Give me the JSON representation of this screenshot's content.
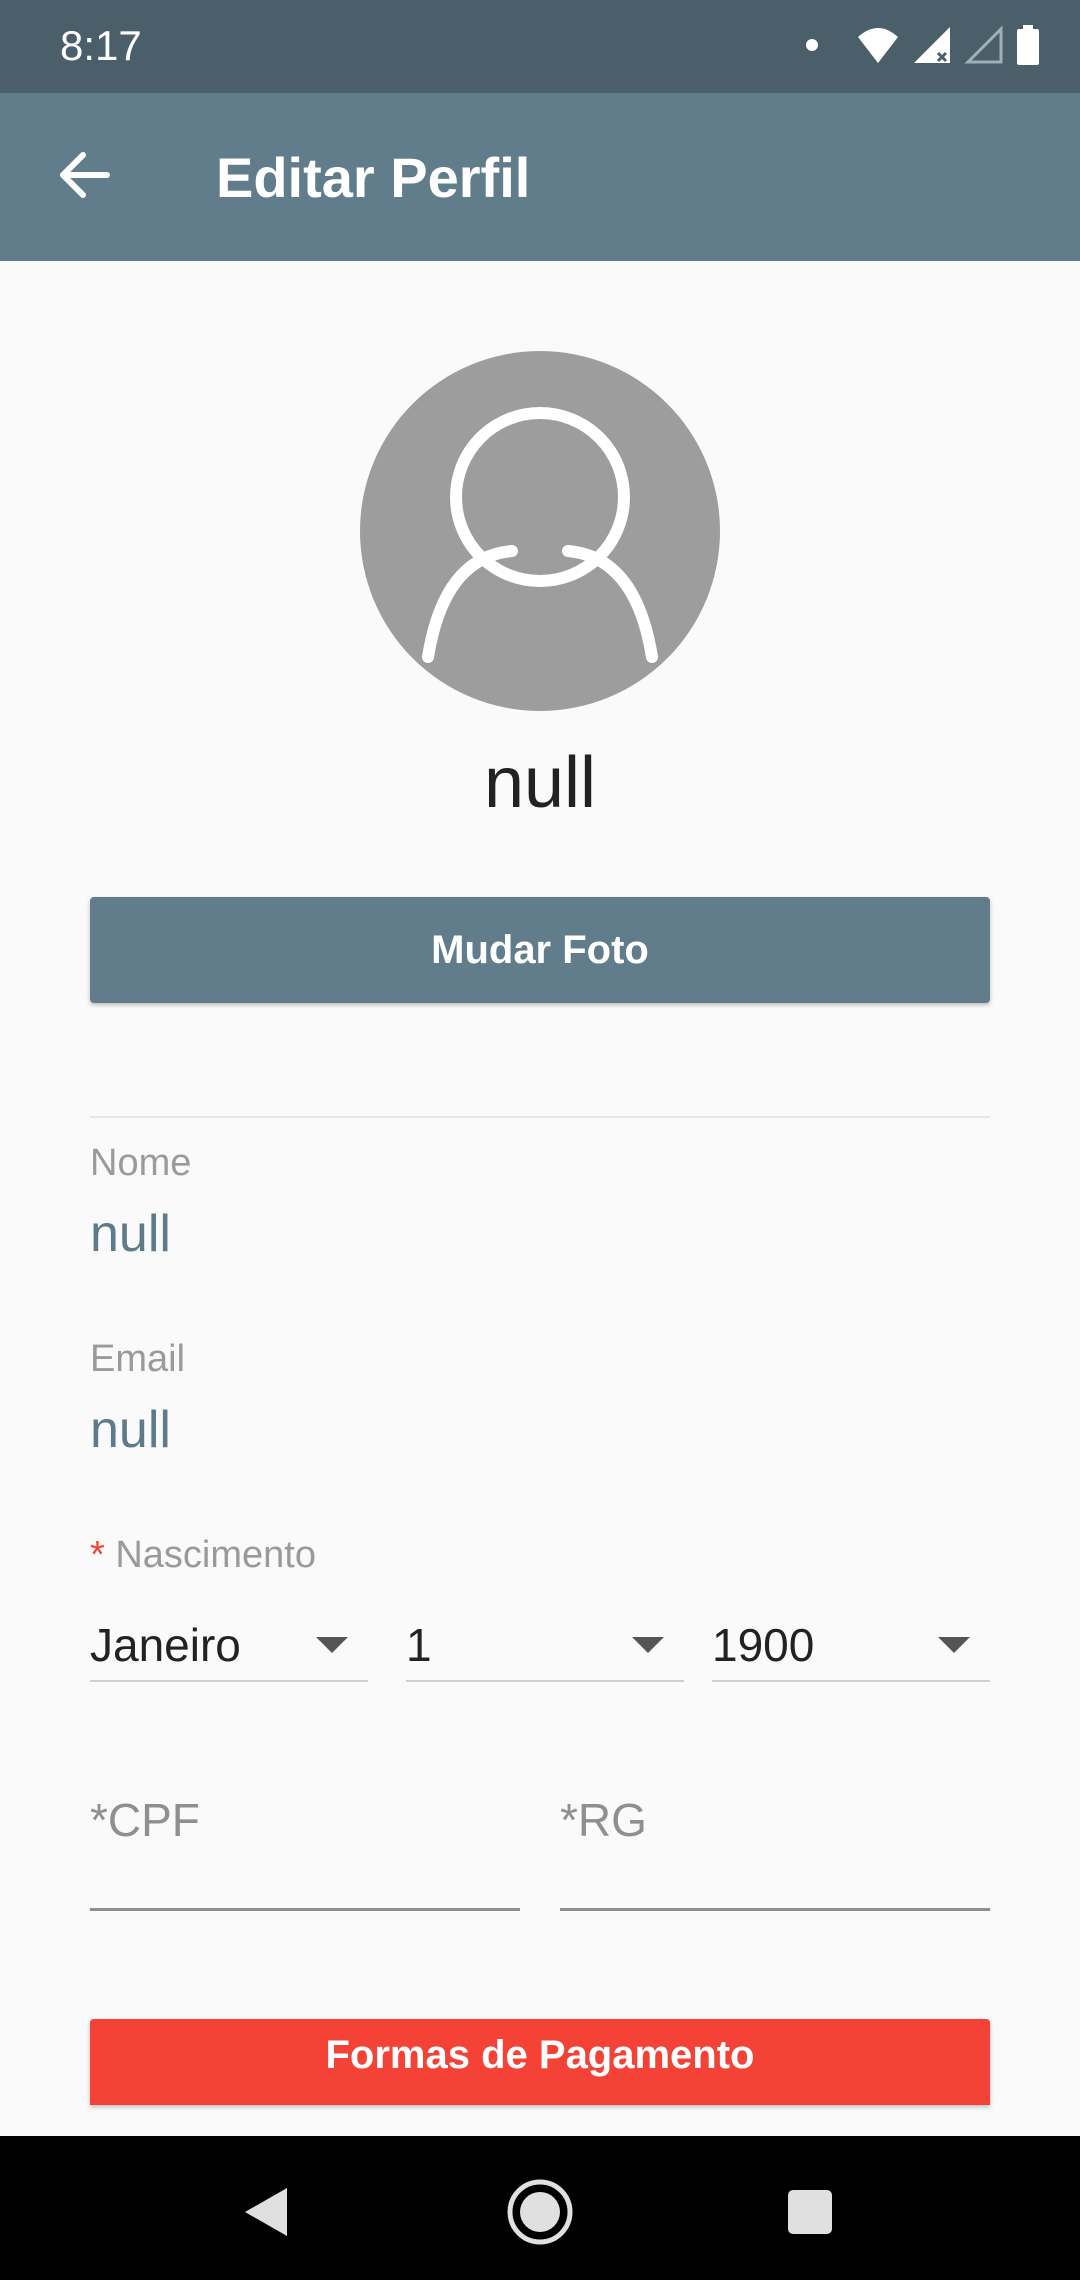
{
  "status_bar": {
    "time": "8:17",
    "icons": [
      "notification-dot-icon",
      "wifi-icon",
      "signal-icon",
      "signal-empty-icon",
      "battery-icon"
    ]
  },
  "app_bar": {
    "title": "Editar Perfil",
    "back_icon": "arrow-back-icon"
  },
  "profile": {
    "avatar_icon": "person-icon",
    "name": "null",
    "change_photo_label": "Mudar Foto"
  },
  "fields": {
    "nome_label": "Nome",
    "nome_value": "null",
    "email_label": "Email",
    "email_value": "null",
    "nascimento_required": "*",
    "nascimento_label": "Nascimento",
    "month": "Janeiro",
    "day": "1",
    "year": "1900",
    "cpf_placeholder": "*CPF",
    "rg_placeholder": "*RG"
  },
  "payment_label": "Formas de Pagamento",
  "nav_bar": {
    "icons": [
      "nav-back-icon",
      "nav-home-icon",
      "nav-recents-icon"
    ]
  },
  "colors": {
    "status_bar": "#4b5f6b",
    "primary": "#617d8b",
    "accent_red": "#f44336",
    "background": "#fafafa"
  }
}
